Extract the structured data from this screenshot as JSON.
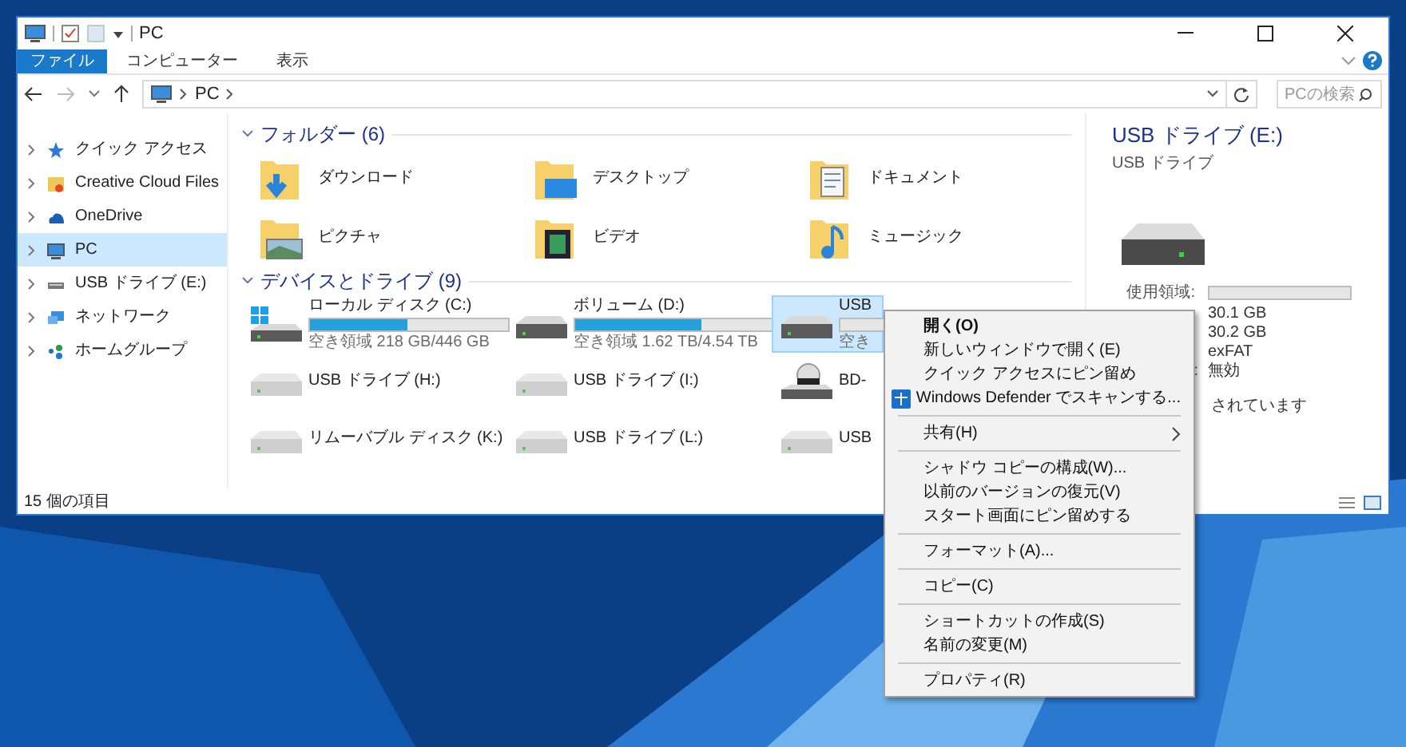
{
  "window": {
    "title": "PC"
  },
  "ribbon_tabs": [
    {
      "label": "ファイル",
      "selected": true
    },
    {
      "label": "コンピューター",
      "selected": false
    },
    {
      "label": "表示",
      "selected": false
    }
  ],
  "address": {
    "path": [
      "PC"
    ]
  },
  "search": {
    "placeholder": "PCの検索"
  },
  "sidebar": {
    "items": [
      {
        "label": "クイック アクセス",
        "selected": false
      },
      {
        "label": "Creative Cloud Files",
        "selected": false
      },
      {
        "label": "OneDrive",
        "selected": false
      },
      {
        "label": "PC",
        "selected": true
      },
      {
        "label": "USB ドライブ (E:)",
        "selected": false
      },
      {
        "label": "ネットワーク",
        "selected": false
      },
      {
        "label": "ホームグループ",
        "selected": false
      }
    ]
  },
  "folders": {
    "heading": "フォルダー (6)",
    "items": [
      {
        "name": "ダウンロード"
      },
      {
        "name": "デスクトップ"
      },
      {
        "name": "ドキュメント"
      },
      {
        "name": "ピクチャ"
      },
      {
        "name": "ビデオ"
      },
      {
        "name": "ミュージック"
      }
    ]
  },
  "drives": {
    "heading": "デバイスとドライブ (9)",
    "items": [
      {
        "name": "ローカル ディスク (C:)",
        "level": 0.49,
        "free": "空き領域 218 GB/446 GB",
        "selected": false
      },
      {
        "name": "ボリューム (D:)",
        "level": 0.64,
        "free": "空き領域 1.62 TB/4.54 TB",
        "selected": false
      },
      {
        "name": "USB",
        "level": 0.0,
        "free": "空き",
        "selected": true
      },
      {
        "name": "USB ドライブ (H:)",
        "selected": false
      },
      {
        "name": "USB ドライブ (I:)",
        "selected": false
      },
      {
        "name": "BD-",
        "selected": false
      },
      {
        "name": "リムーバブル ディスク (K:)",
        "selected": false
      },
      {
        "name": "USB ドライブ (L:)",
        "selected": false
      },
      {
        "name": "USB",
        "selected": false
      }
    ]
  },
  "details": {
    "title": "USB ドライブ (E:)",
    "subtitle": "USB ドライブ",
    "used": {
      "label": "使用領域:",
      "level": 0.0
    },
    "values": [
      {
        "value": "30.1 GB"
      },
      {
        "value": "30.2 GB"
      },
      {
        "value": "exFAT"
      },
      {
        "label": ":",
        "value": "無効"
      }
    ],
    "note": "されています"
  },
  "status_bar": {
    "text": "15 個の項目"
  },
  "context_menu": {
    "groups": [
      [
        {
          "label": "開く(O)",
          "bold": true,
          "submenu": false
        },
        {
          "label": "新しいウィンドウで開く(E)",
          "bold": false,
          "submenu": false
        },
        {
          "label": "クイック アクセスにピン留め",
          "bold": false,
          "submenu": false
        },
        {
          "label": "Windows Defender でスキャンする...",
          "bold": false,
          "submenu": false
        }
      ],
      [
        {
          "label": "共有(H)",
          "bold": false,
          "submenu": true
        }
      ],
      [
        {
          "label": "シャドウ コピーの構成(W)...",
          "bold": false,
          "submenu": false
        },
        {
          "label": "以前のバージョンの復元(V)",
          "bold": false,
          "submenu": false
        },
        {
          "label": "スタート画面にピン留めする",
          "bold": false,
          "submenu": false
        }
      ],
      [
        {
          "label": "フォーマット(A)...",
          "bold": false,
          "submenu": false
        }
      ],
      [
        {
          "label": "コピー(C)",
          "bold": false,
          "submenu": false
        }
      ],
      [
        {
          "label": "ショートカットの作成(S)",
          "bold": false,
          "submenu": false
        },
        {
          "label": "名前の変更(M)",
          "bold": false,
          "submenu": false
        }
      ],
      [
        {
          "label": "プロパティ(R)",
          "bold": false,
          "submenu": false
        }
      ]
    ]
  }
}
